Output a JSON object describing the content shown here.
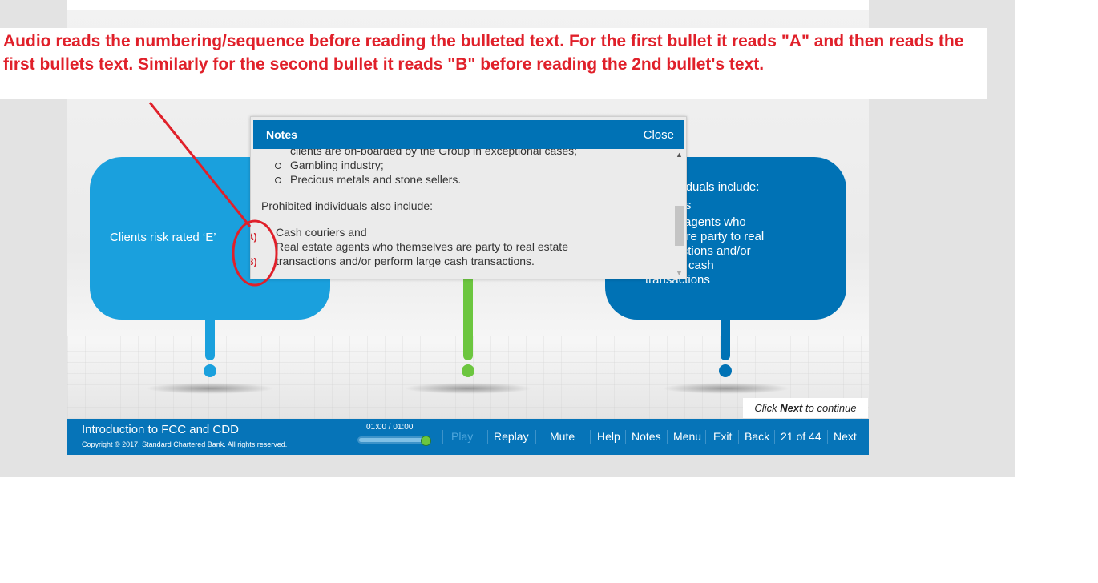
{
  "annotation": {
    "text": "Audio reads the numbering/sequence before reading the bulleted text. For the first bullet it reads \"A\" and then reads the first bullets text. Similarly for the second bullet it reads \"B\" before reading the 2nd bullet's text.",
    "color": "#e0202a",
    "markers": [
      "A)",
      "B)"
    ]
  },
  "slide": {
    "left_bubble": {
      "text": "Clients risk rated ‘E’",
      "color": "#1aa0dd"
    },
    "middle_bubble": {
      "color": "#6cc63f"
    },
    "right_bubble": {
      "color": "#0072b5",
      "lines": [
        "d individuals include:",
        "couriers",
        "estate agents who",
        "elves are party to real",
        "transactions and/or",
        "n large cash",
        "transactions"
      ]
    },
    "click_next": {
      "prefix": "Click ",
      "bold": "Next",
      "suffix": " to continue"
    }
  },
  "notes_panel": {
    "title": "Notes",
    "close_label": "Close",
    "lines": {
      "cut_off": "clients are on-boarded by the Group in exceptional cases;",
      "bullet1": "Gambling industry;",
      "bullet2": "Precious metals and stone sellers.",
      "heading": "Prohibited individuals also include:",
      "item_a": "Cash couriers and",
      "item_b1": "Real estate agents who themselves are party to real estate",
      "item_b2": "transactions and/or perform large cash transactions."
    },
    "scroll_position": 0.7
  },
  "footer": {
    "course_title": "Introduction to FCC and CDD",
    "copyright": "Copyright © 2017. Standard Chartered Bank. All rights reserved.",
    "time": "01:00 / 01:00",
    "progress": 1.0,
    "controls": {
      "play": "Play",
      "replay": "Replay",
      "mute": "Mute",
      "help": "Help",
      "notes": "Notes",
      "menu": "Menu",
      "exit": "Exit",
      "back": "Back",
      "page": "21 of 44",
      "next": "Next"
    },
    "color": "#0674b8"
  }
}
